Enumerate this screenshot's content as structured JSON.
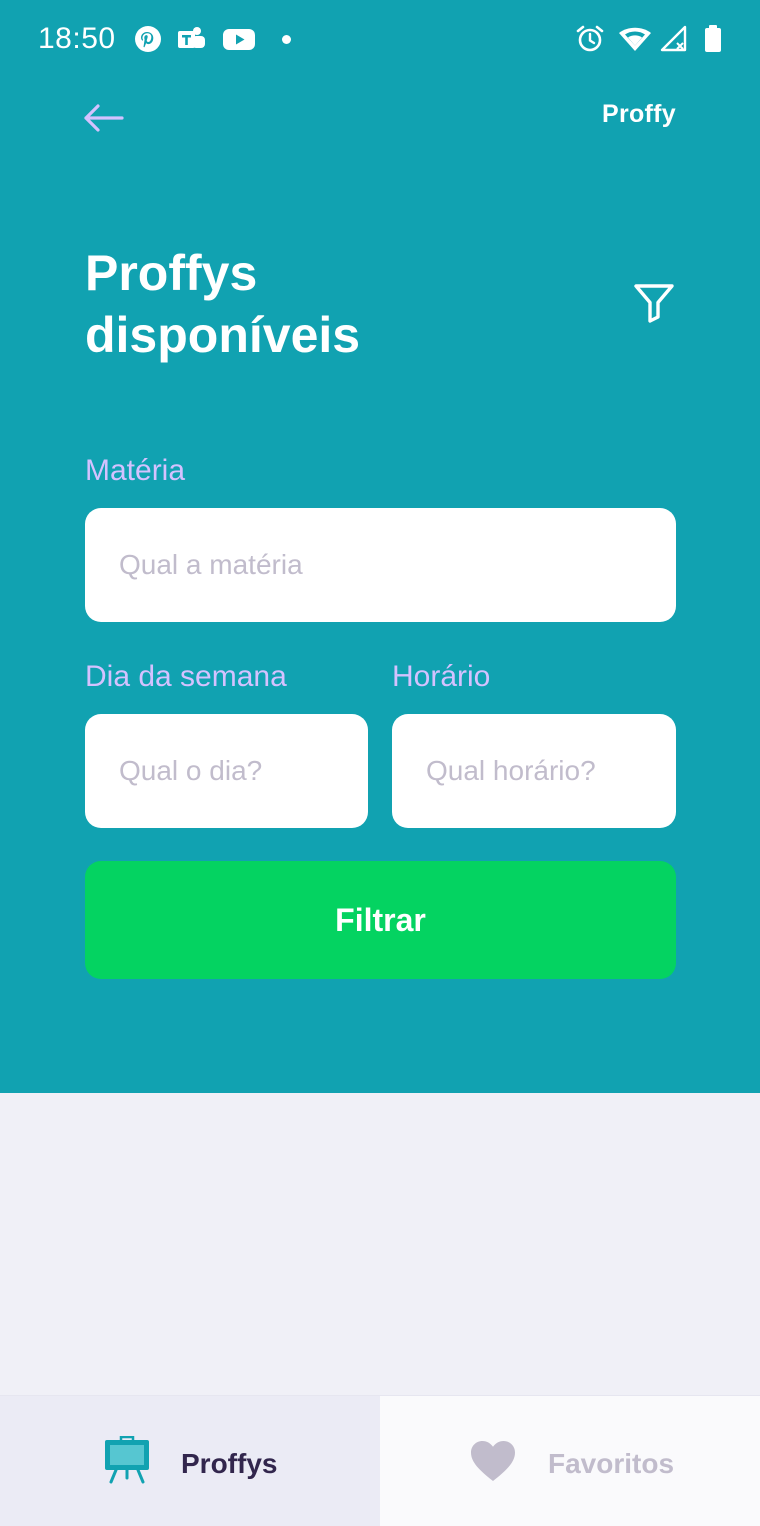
{
  "status_bar": {
    "time": "18:50",
    "left_icons": [
      "pinterest-icon",
      "teams-icon",
      "youtube-icon",
      "notification-dot"
    ],
    "right_icons": [
      "alarm-icon",
      "wifi-icon",
      "signal-icon",
      "battery-icon"
    ]
  },
  "header": {
    "brand": "Proffy",
    "title_line1": "Proffys",
    "title_line2": "disponíveis",
    "background_color": "#11A2B1"
  },
  "form": {
    "subject_label": "Matéria",
    "subject_placeholder": "Qual a matéria",
    "weekday_label": "Dia da semana",
    "weekday_placeholder": "Qual o dia?",
    "time_label": "Horário",
    "time_placeholder": "Qual horário?",
    "submit_label": "Filtrar",
    "submit_color": "#04D361"
  },
  "tabs": [
    {
      "label": "Proffys",
      "icon": "easel-icon",
      "active": true
    },
    {
      "label": "Favoritos",
      "icon": "heart-icon",
      "active": false
    }
  ]
}
